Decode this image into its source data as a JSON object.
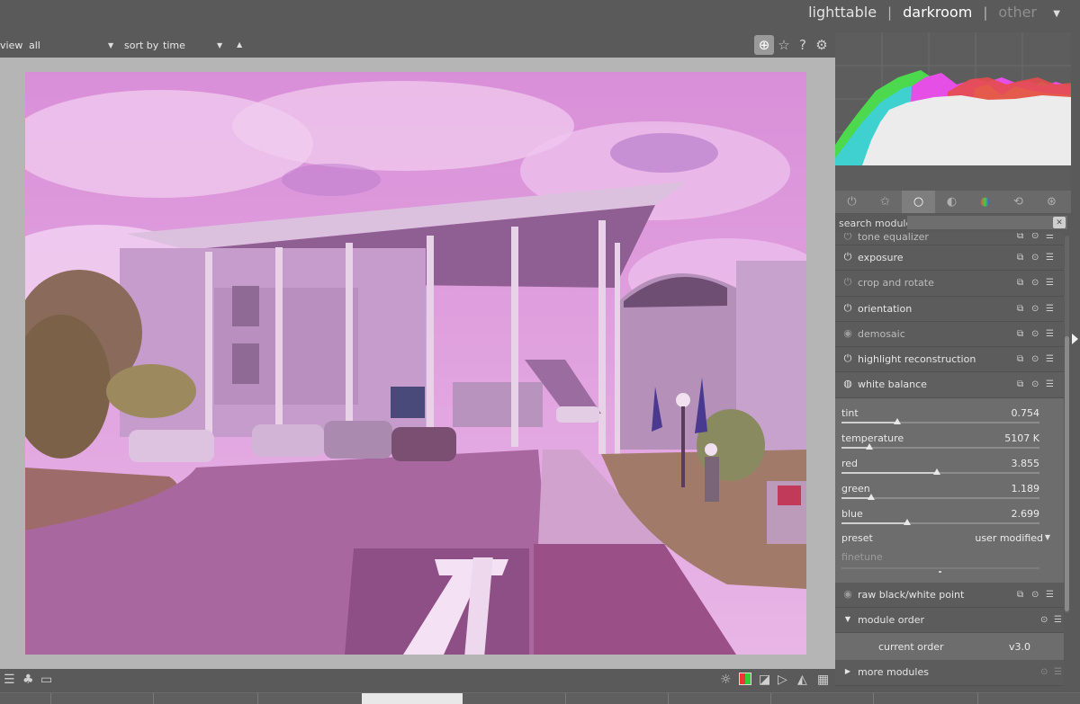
{
  "views": {
    "lighttable": "lighttable",
    "darkroom": "darkroom",
    "other": "other",
    "separator": "|"
  },
  "filterbar": {
    "view_label": "view",
    "view_value": "all",
    "sort_label": "sort by",
    "sort_value": "time"
  },
  "histogram": {
    "colors": [
      "#4dd94d",
      "#3fd0d0",
      "#e54fe5",
      "#e0e03c",
      "#e64c4c",
      "#ececec"
    ]
  },
  "group_tabs": [
    {
      "icon": "power-icon",
      "glyph": "⏻"
    },
    {
      "icon": "star-icon",
      "glyph": "☆"
    },
    {
      "icon": "circle-icon",
      "glyph": "○"
    },
    {
      "icon": "tone-icon",
      "glyph": "◐"
    },
    {
      "icon": "color-icon",
      "glyph": "●"
    },
    {
      "icon": "correct-icon",
      "glyph": "⟲"
    },
    {
      "icon": "effect-icon",
      "glyph": "⊛"
    }
  ],
  "search": {
    "label": "search module",
    "value": ""
  },
  "modules": {
    "tone_equalizer": "tone equalizer",
    "exposure": "exposure",
    "crop_and_rotate": "crop and rotate",
    "orientation": "orientation",
    "demosaic": "demosaic",
    "highlight_reconstruction": "highlight reconstruction",
    "white_balance": "white balance",
    "raw_black_white_point": "raw black/white point",
    "module_order": "module order",
    "more_modules": "more modules"
  },
  "white_balance": {
    "sliders": [
      {
        "label": "tint",
        "value": "0.754",
        "fraction": 0.28
      },
      {
        "label": "temperature",
        "value": "5107 K",
        "fraction": 0.14
      },
      {
        "label": "red",
        "value": "3.855",
        "fraction": 0.48
      },
      {
        "label": "green",
        "value": "1.189",
        "fraction": 0.15
      },
      {
        "label": "blue",
        "value": "2.699",
        "fraction": 0.33
      }
    ],
    "preset_label": "preset",
    "preset_value": "user modified",
    "finetune_label": "finetune"
  },
  "module_order": {
    "current_label": "current order",
    "current_value": "v3.0"
  }
}
